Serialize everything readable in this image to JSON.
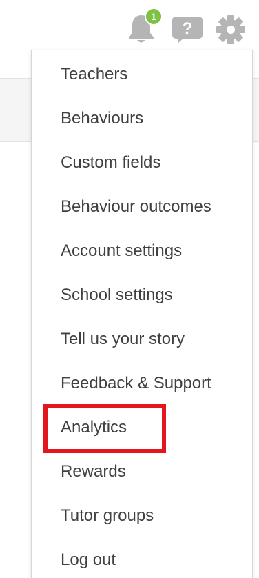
{
  "topbar": {
    "notifications": {
      "icon": "bell-icon",
      "badge_count": "1",
      "badge_color": "#7dc242"
    },
    "help": {
      "icon": "help-question-icon"
    },
    "settings": {
      "icon": "gear-icon"
    }
  },
  "menu": {
    "items": [
      {
        "label": "Teachers"
      },
      {
        "label": "Behaviours"
      },
      {
        "label": "Custom fields"
      },
      {
        "label": "Behaviour outcomes"
      },
      {
        "label": "Account settings"
      },
      {
        "label": "School settings"
      },
      {
        "label": "Tell us your story"
      },
      {
        "label": "Feedback & Support"
      },
      {
        "label": "Analytics"
      },
      {
        "label": "Rewards"
      },
      {
        "label": "Tutor groups"
      },
      {
        "label": "Log out"
      }
    ],
    "highlighted_item": "Analytics",
    "highlight_color": "#e3161e"
  },
  "colors": {
    "icon_gray": "#b5b5b5",
    "text": "#404040"
  }
}
